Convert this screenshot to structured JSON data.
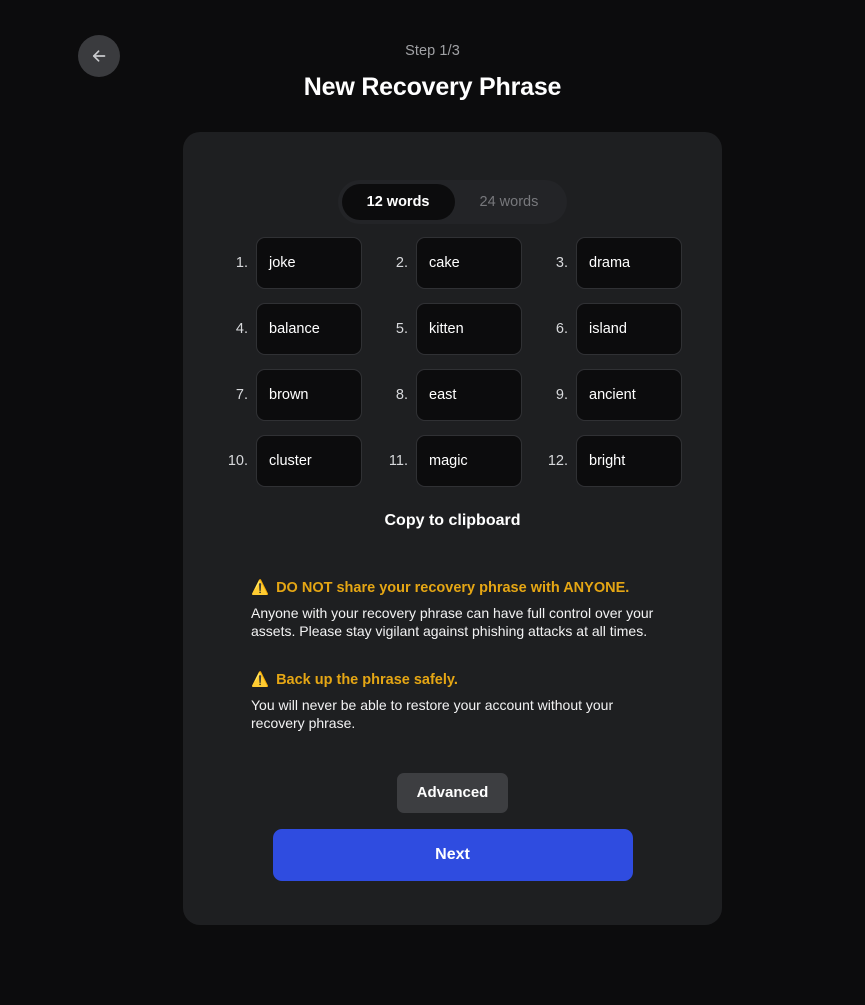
{
  "nav": {
    "back_icon": "arrow-left-icon"
  },
  "header": {
    "step": "Step 1/3",
    "title": "New Recovery Phrase"
  },
  "toggle": {
    "options": [
      {
        "label": "12 words",
        "active": true
      },
      {
        "label": "24 words",
        "active": false
      }
    ]
  },
  "phrase": {
    "words": [
      {
        "index": "1.",
        "word": "joke"
      },
      {
        "index": "2.",
        "word": "cake"
      },
      {
        "index": "3.",
        "word": "drama"
      },
      {
        "index": "4.",
        "word": "balance"
      },
      {
        "index": "5.",
        "word": "kitten"
      },
      {
        "index": "6.",
        "word": "island"
      },
      {
        "index": "7.",
        "word": "brown"
      },
      {
        "index": "8.",
        "word": "east"
      },
      {
        "index": "9.",
        "word": "ancient"
      },
      {
        "index": "10.",
        "word": "cluster"
      },
      {
        "index": "11.",
        "word": "magic"
      },
      {
        "index": "12.",
        "word": "bright"
      }
    ],
    "copy_label": "Copy to clipboard"
  },
  "warnings": [
    {
      "icon": "warning-triangle-icon",
      "glyph": "⚠️",
      "title": "DO NOT share your recovery phrase with ANYONE.",
      "body": "Anyone with your recovery phrase can have full control over your assets. Please stay vigilant against phishing attacks at all times."
    },
    {
      "icon": "warning-triangle-icon",
      "glyph": "⚠️",
      "title": "Back up the phrase safely.",
      "body": "You will never be able to restore your account without your recovery phrase."
    }
  ],
  "footer": {
    "advanced_label": "Advanced",
    "next_label": "Next"
  },
  "colors": {
    "page_background": "#0c0c0d",
    "card_background": "#1e1f21",
    "field_background": "#0c0c0d",
    "field_border": "#303134",
    "warning_accent": "#e5a614",
    "primary_button": "#2f4ce0",
    "secondary_button": "#3d3e41",
    "muted_text": "#77787c"
  }
}
